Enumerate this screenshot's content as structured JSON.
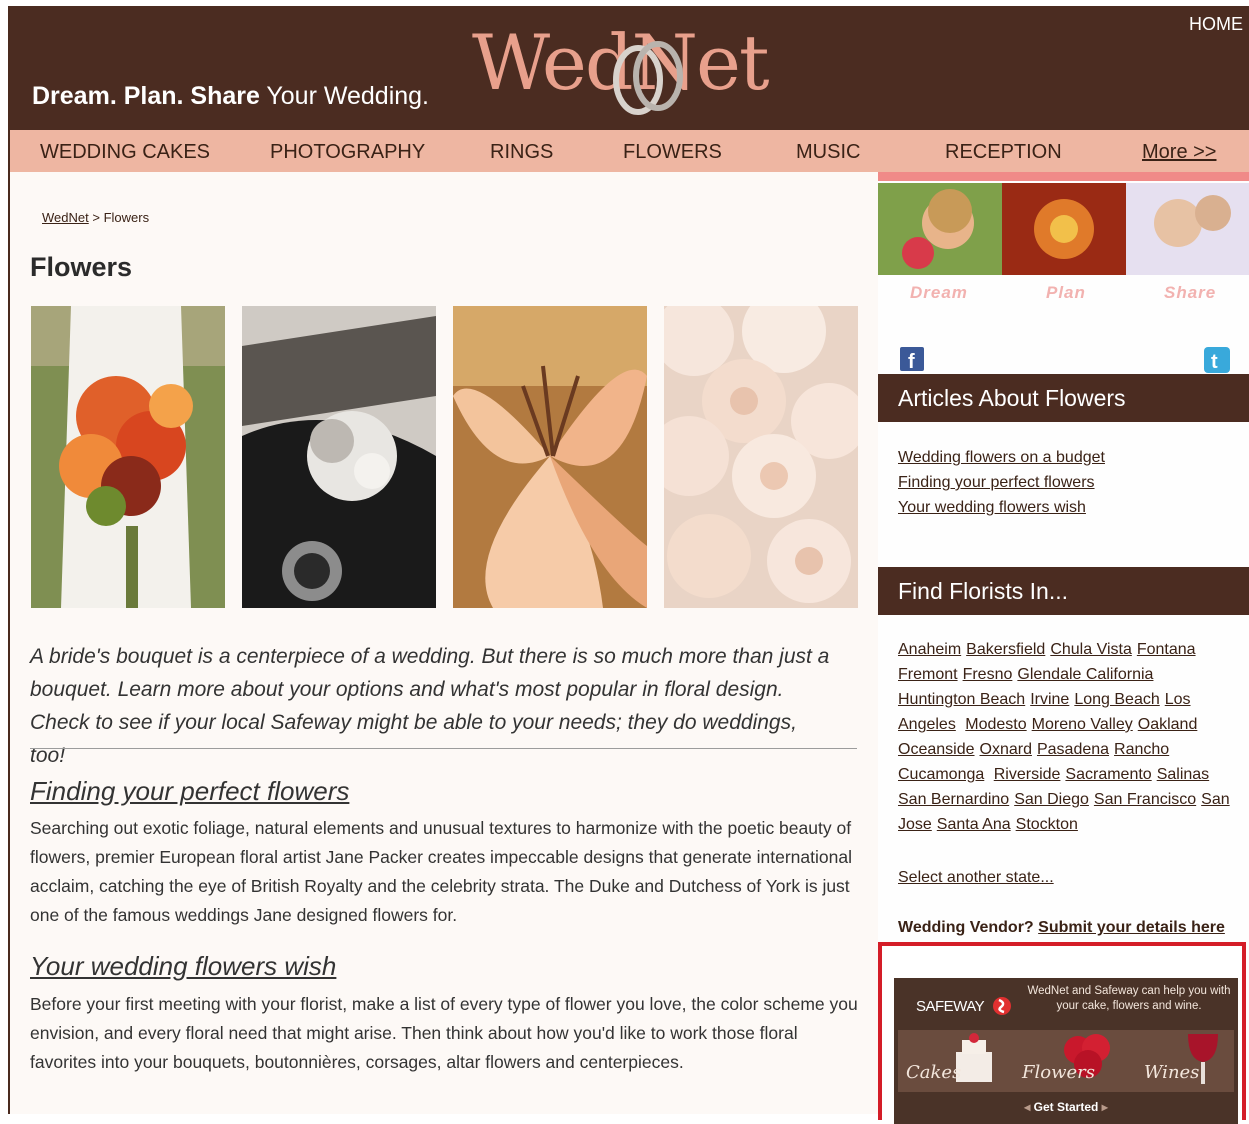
{
  "header": {
    "tagline_bold": "Dream. Plan. Share",
    "tagline_rest": " Your Wedding.",
    "logo": "WedNet",
    "home": "HOME"
  },
  "nav": {
    "items": [
      "WEDDING CAKES",
      "PHOTOGRAPHY",
      "RINGS",
      "FLOWERS",
      "MUSIC",
      "RECEPTION"
    ],
    "more": "More >>"
  },
  "breadcrumb": {
    "home": "WedNet",
    "separator": " > ",
    "current": "Flowers"
  },
  "page_title": "Flowers",
  "intro": "A bride's bouquet is a centerpiece of a wedding. But there is so much more than just a bouquet. Learn more about your options and what's most popular in floral design. Check to see if your local Safeway might be able to your needs; they do weddings, too!",
  "articles": [
    {
      "title": "Finding your perfect flowers",
      "body": "Searching out exotic foliage, natural elements and unusual textures to harmonize with the poetic beauty of flowers, premier European floral artist Jane Packer creates impeccable designs that generate international acclaim, catching the eye of British Royalty and the celebrity strata. The Duke and Dutchess of York is just one of the famous weddings Jane designed flowers for."
    },
    {
      "title": "Your wedding flowers wish",
      "body": "Before your first meeting with your florist, make a list of every type of flower you love, the color scheme you envision, and every floral need that might arise. Then think about how you'd like to work those floral favorites into your bouquets, boutonnières, corsages, altar flowers and centerpieces."
    }
  ],
  "sidebar": {
    "captions": [
      "Dream",
      "Plan",
      "Share"
    ],
    "articles_title": "Articles About Flowers",
    "article_links": [
      "Wedding flowers on a budget",
      "Finding your perfect flowers",
      "Your wedding flowers wish"
    ],
    "florists_title": "Find Florists In...",
    "cities": [
      "Anaheim",
      "Bakersfield",
      "Chula Vista",
      "Fontana",
      "Fremont",
      "Fresno",
      "Glendale California",
      "Huntington Beach",
      "Irvine",
      "Long Beach",
      "Los Angeles",
      "Modesto",
      "Moreno Valley",
      "Oakland",
      "Oceanside",
      "Oxnard",
      "Pasadena",
      "Rancho Cucamonga",
      "Riverside",
      "Sacramento",
      "Salinas",
      "San Bernardino",
      "San Diego",
      "San Francisco",
      "San Jose",
      "Santa Ana",
      "Stockton"
    ],
    "select_state": "Select another state...",
    "vendor_label": "Wedding Vendor?",
    "vendor_link": "Submit your details here"
  },
  "ad": {
    "brand": "SAFEWAY",
    "text": "WedNet and Safeway can help you with your cake, flowers and wine.",
    "tiles": [
      "Cakes",
      "Flowers",
      "Wines"
    ],
    "cta": "Get Started"
  },
  "colors": {
    "brown": "#4b2c21",
    "nav_pink": "#eeb6a2",
    "logo_salmon": "#e8a08c",
    "ad_border": "#d41d28"
  }
}
